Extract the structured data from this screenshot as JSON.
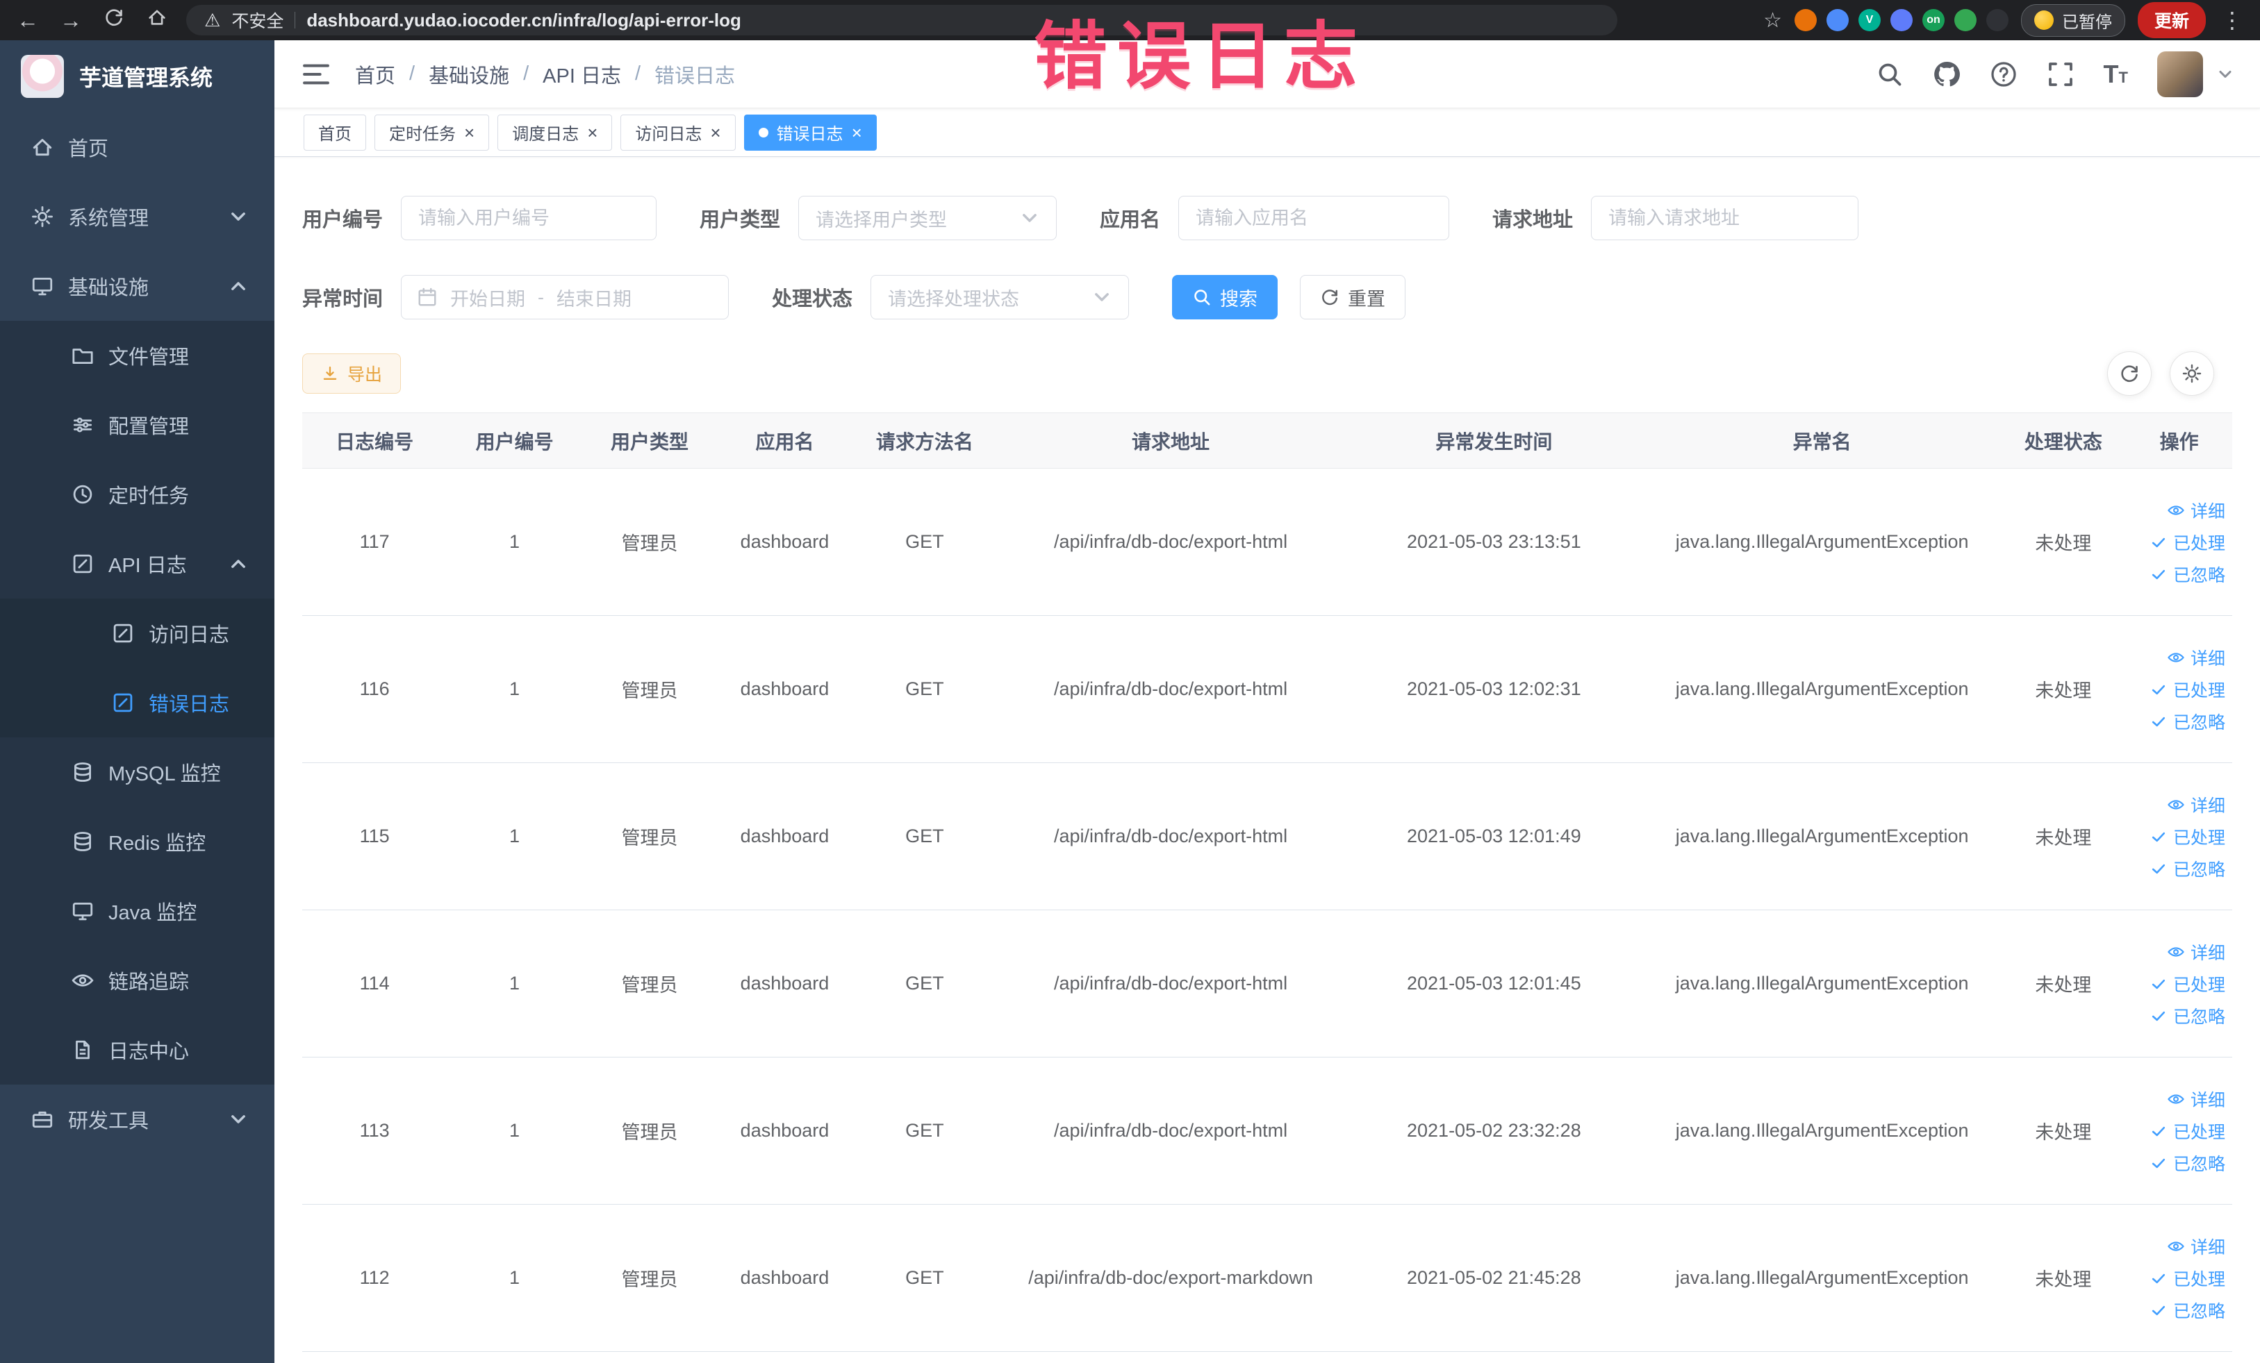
{
  "colors": {
    "accent": "#409eff",
    "warning": "#e6a23c",
    "sidebar_bg": "#304156",
    "annotation": "#f2486f",
    "active_tab_bg": "#409eff"
  },
  "browser": {
    "security_label": "不安全",
    "url": "dashboard.yudao.iocoder.cn/infra/log/api-error-log",
    "extensions": [
      {
        "color": "#e8710a",
        "label": ""
      },
      {
        "color": "#4e8cf9",
        "label": ""
      },
      {
        "color": "#00b294",
        "label": "V"
      },
      {
        "color": "#5f7cfa",
        "label": ""
      },
      {
        "color": "#18a058",
        "label": "on"
      },
      {
        "color": "#34a853",
        "label": ""
      },
      {
        "color": "#2f3136",
        "label": ""
      }
    ],
    "paused_label": "已暂停",
    "update_label": "更新"
  },
  "annotation": {
    "text": "错误日志"
  },
  "sidebar": {
    "logo_title": "芋道管理系统",
    "items": [
      {
        "label": "首页"
      },
      {
        "label": "系统管理"
      },
      {
        "label": "基础设施"
      },
      {
        "label": "文件管理"
      },
      {
        "label": "配置管理"
      },
      {
        "label": "定时任务"
      },
      {
        "label": "API 日志"
      },
      {
        "label": "访问日志"
      },
      {
        "label": "错误日志"
      },
      {
        "label": "MySQL 监控"
      },
      {
        "label": "Redis 监控"
      },
      {
        "label": "Java 监控"
      },
      {
        "label": "链路追踪"
      },
      {
        "label": "日志中心"
      },
      {
        "label": "研发工具"
      }
    ]
  },
  "header": {
    "breadcrumb": [
      {
        "label": "首页"
      },
      {
        "label": "基础设施"
      },
      {
        "label": "API 日志"
      },
      {
        "label": "错误日志"
      }
    ],
    "separator": "/"
  },
  "tabs": [
    {
      "label": "首页"
    },
    {
      "label": "定时任务"
    },
    {
      "label": "调度日志"
    },
    {
      "label": "访问日志"
    },
    {
      "label": "错误日志"
    }
  ],
  "filters": {
    "user_id_label": "用户编号",
    "user_id_placeholder": "请输入用户编号",
    "user_type_label": "用户类型",
    "user_type_placeholder": "请选择用户类型",
    "app_name_label": "应用名",
    "app_name_placeholder": "请输入应用名",
    "request_url_label": "请求地址",
    "request_url_placeholder": "请输入请求地址",
    "exception_time_label": "异常时间",
    "date_start_placeholder": "开始日期",
    "date_separator": "-",
    "date_end_placeholder": "结束日期",
    "process_status_label": "处理状态",
    "process_status_placeholder": "请选择处理状态",
    "search_label": "搜索",
    "reset_label": "重置"
  },
  "toolbar": {
    "export_label": "导出"
  },
  "table": {
    "columns": [
      "日志编号",
      "用户编号",
      "用户类型",
      "应用名",
      "请求方法名",
      "请求地址",
      "异常发生时间",
      "异常名",
      "处理状态",
      "操作"
    ],
    "actions": [
      "详细",
      "已处理",
      "已忽略"
    ],
    "rows": [
      {
        "log_id": "117",
        "user_id": "1",
        "user_type": "管理员",
        "app_name": "dashboard",
        "method": "GET",
        "url": "/api/infra/db-doc/export-html",
        "time": "2021-05-03 23:13:51",
        "exception": "java.lang.IllegalArgumentException",
        "status": "未处理"
      },
      {
        "log_id": "116",
        "user_id": "1",
        "user_type": "管理员",
        "app_name": "dashboard",
        "method": "GET",
        "url": "/api/infra/db-doc/export-html",
        "time": "2021-05-03 12:02:31",
        "exception": "java.lang.IllegalArgumentException",
        "status": "未处理"
      },
      {
        "log_id": "115",
        "user_id": "1",
        "user_type": "管理员",
        "app_name": "dashboard",
        "method": "GET",
        "url": "/api/infra/db-doc/export-html",
        "time": "2021-05-03 12:01:49",
        "exception": "java.lang.IllegalArgumentException",
        "status": "未处理"
      },
      {
        "log_id": "114",
        "user_id": "1",
        "user_type": "管理员",
        "app_name": "dashboard",
        "method": "GET",
        "url": "/api/infra/db-doc/export-html",
        "time": "2021-05-03 12:01:45",
        "exception": "java.lang.IllegalArgumentException",
        "status": "未处理"
      },
      {
        "log_id": "113",
        "user_id": "1",
        "user_type": "管理员",
        "app_name": "dashboard",
        "method": "GET",
        "url": "/api/infra/db-doc/export-html",
        "time": "2021-05-02 23:32:28",
        "exception": "java.lang.IllegalArgumentException",
        "status": "未处理"
      },
      {
        "log_id": "112",
        "user_id": "1",
        "user_type": "管理员",
        "app_name": "dashboard",
        "method": "GET",
        "url": "/api/infra/db-doc/export-markdown",
        "time": "2021-05-02 21:45:28",
        "exception": "java.lang.IllegalArgumentException",
        "status": "未处理"
      }
    ]
  }
}
